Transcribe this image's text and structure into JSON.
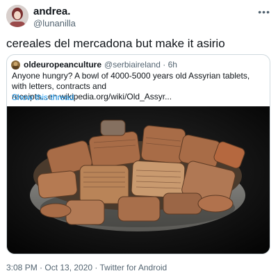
{
  "tweet": {
    "display_name": "andrea.",
    "handle": "@lunanilla",
    "more_label": "•••",
    "text": "cereales del mercadona but make it asirio",
    "footer": "3:08 PM · Oct 13, 2020 · Twitter for Android"
  },
  "quoted": {
    "display_name": "oldeuropeanculture",
    "handle_time": "@serbiaireland · 6h",
    "text": "Anyone hungry? A bowl of 4000-5000 years old Assyrian tablets, with letters, contracts and receipts...en.wikipedia.org/wiki/Old_Assyr...",
    "show_thread": "Show this thread"
  },
  "colors": {
    "link": "#1d9bf0",
    "muted": "#536471",
    "border": "#cfd9de"
  }
}
